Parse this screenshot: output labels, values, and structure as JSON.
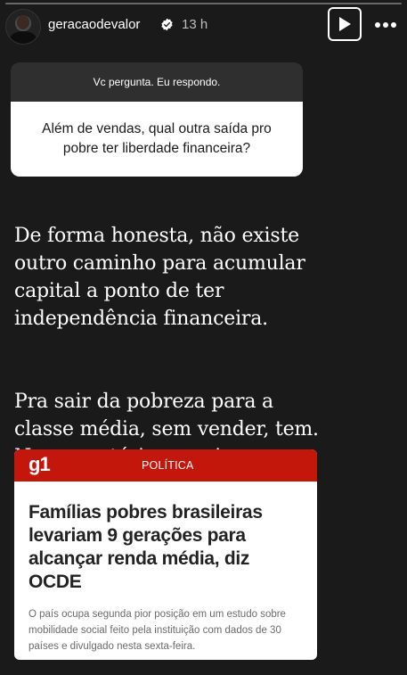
{
  "header": {
    "username": "geracaodevalor",
    "time": "13 h",
    "verified": true,
    "icons": {
      "avatar": "avatar",
      "verified": "verified-badge-icon",
      "play": "play-icon",
      "more": "more-options-icon"
    }
  },
  "question_box": {
    "title": "Vc pergunta. Eu respondo.",
    "question": "Além de vendas, qual outra saída pro pobre ter liberdade financeira?"
  },
  "answer": {
    "paragraph1": "De forma honesta, não existe\noutro caminho para acumular\ncapital a ponto de ter\nindependência financeira.",
    "paragraph2": "Pra sair da pobreza para a\nclasse média, sem vender, tem.\nNessa matéria menciona."
  },
  "news_card": {
    "logo": "g1",
    "section": "POLÍTICA",
    "headline": "Famílias pobres brasileiras levariam 9 gerações para alcançar renda média, diz OCDE",
    "summary": "O país ocupa segunda pior posição em um estudo sobre mobilidade social feito pela instituição com dados de 30 países e divulgado nesta sexta-feira.",
    "brand_color": "#c4170c"
  }
}
